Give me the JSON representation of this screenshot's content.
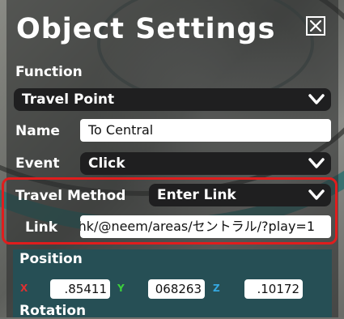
{
  "window": {
    "title": "Object Settings"
  },
  "function": {
    "label": "Function",
    "selected": "Travel Point"
  },
  "name": {
    "label": "Name",
    "value": "To Central"
  },
  "event": {
    "label": "Event",
    "selected": "Click"
  },
  "travel_method": {
    "label": "Travel Method",
    "selected": "Enter Link"
  },
  "link": {
    "label": "Link",
    "value": "hk/@neem/areas/セントラル/?play=1"
  },
  "position": {
    "label": "Position",
    "x_label": "X",
    "x_value": ".85411",
    "y_label": "Y",
    "y_value": "068263",
    "z_label": "Z",
    "z_value": ".10172"
  },
  "rotation": {
    "label": "Rotation"
  },
  "colors": {
    "highlight": "#e01d1d",
    "x_axis": "#e03030",
    "y_axis": "#3cd13c",
    "z_axis": "#35a8e0",
    "position_panel": "#264f55"
  },
  "icons": {
    "close": "close-icon",
    "chevron": "chevron-down-icon"
  }
}
